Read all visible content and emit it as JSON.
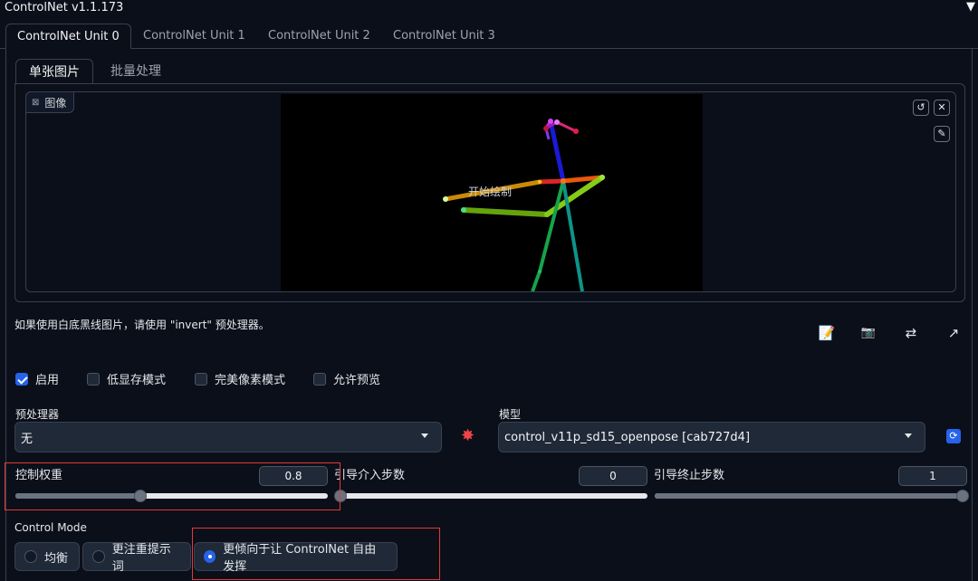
{
  "header": {
    "title": "ControlNet v1.1.173",
    "collapse_icon": "▼"
  },
  "unit_tabs": [
    "ControlNet Unit 0",
    "ControlNet Unit 1",
    "ControlNet Unit 2",
    "ControlNet Unit 3"
  ],
  "mode_tabs": [
    "单张图片",
    "批量处理"
  ],
  "image_panel": {
    "label": "图像",
    "overlay_text": "开始绘制"
  },
  "hint": "如果使用白底黑线图片，请使用 \"invert\" 预处理器。",
  "tools": {
    "edit": "📝",
    "camera": "📷",
    "swap": "⇄",
    "send": "↗"
  },
  "checkboxes": [
    {
      "label": "启用",
      "checked": true
    },
    {
      "label": "低显存模式",
      "checked": false
    },
    {
      "label": "完美像素模式",
      "checked": false
    },
    {
      "label": "允许预览",
      "checked": false
    }
  ],
  "preprocessor": {
    "label": "预处理器",
    "value": "无"
  },
  "model": {
    "label": "模型",
    "value": "control_v11p_sd15_openpose [cab727d4]"
  },
  "sliders": [
    {
      "label": "控制权重",
      "value": "0.8",
      "fraction": 0.4
    },
    {
      "label": "引导介入步数",
      "value": "0",
      "fraction": 0.0
    },
    {
      "label": "引导终止步数",
      "value": "1",
      "fraction": 1.0
    }
  ],
  "control_mode": {
    "label": "Control Mode",
    "options": [
      {
        "label": "均衡",
        "selected": false
      },
      {
        "label": "更注重提示词",
        "selected": false
      },
      {
        "label": "更倾向于让 ControlNet 自由发挥",
        "selected": true
      }
    ]
  },
  "accent_color": "#2563eb",
  "highlight_color": "#e53935"
}
